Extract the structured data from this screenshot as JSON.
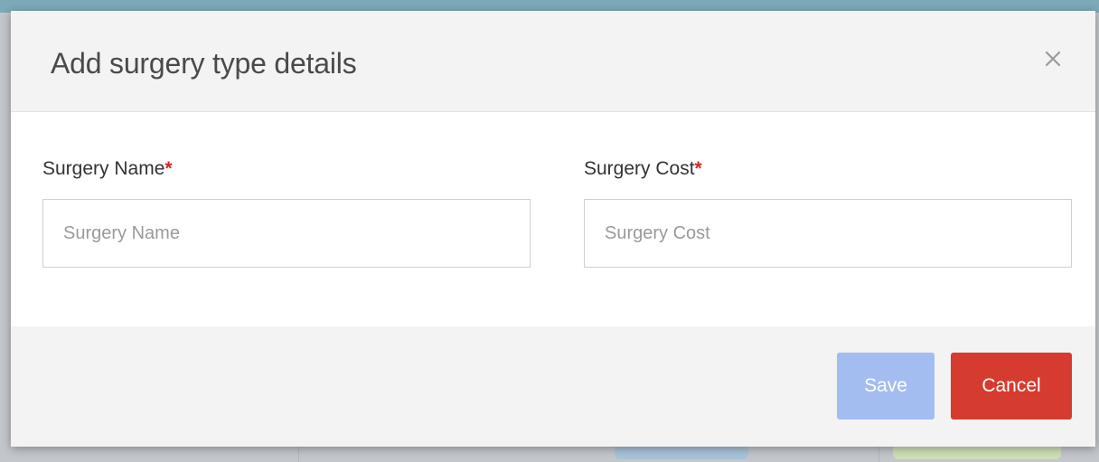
{
  "modal": {
    "title": "Add surgery type details",
    "close_icon": "close-icon"
  },
  "form": {
    "surgery_name": {
      "label": "Surgery Name",
      "required_marker": "*",
      "placeholder": "Surgery Name",
      "value": ""
    },
    "surgery_cost": {
      "label": "Surgery Cost",
      "required_marker": "*",
      "placeholder": "Surgery Cost",
      "value": ""
    }
  },
  "footer": {
    "save_label": "Save",
    "cancel_label": "Cancel"
  },
  "colors": {
    "required": "#e02020",
    "save_button": "#a3bdf0",
    "cancel_button": "#d63b30",
    "header_bg": "#f3f3f3"
  }
}
